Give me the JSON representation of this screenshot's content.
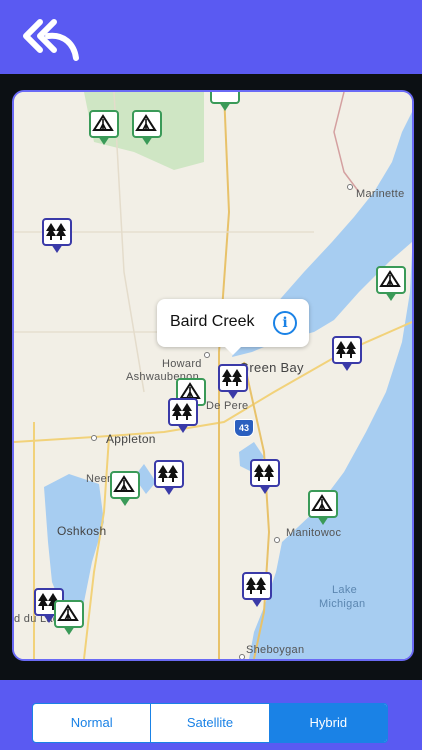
{
  "header": {
    "back_icon": "double-back-arrow-icon"
  },
  "map": {
    "callout": {
      "title": "Baird Creek",
      "info_icon": "info-icon"
    },
    "places": {
      "marinette": "Marinette",
      "green_bay": "Green Bay",
      "howard": "Howard",
      "ashwaubenon": "Ashwaubenon",
      "de_pere": "De Pere",
      "appleton": "Appleton",
      "neenah": "Neenah",
      "oshkosh": "Oshkosh",
      "manitowoc": "Manitowoc",
      "lake_michigan_1": "Lake",
      "lake_michigan_2": "Michigan",
      "sheboygan": "Sheboygan",
      "fond_du_lac": "d du Lac",
      "interstate": "43"
    },
    "pins": [
      {
        "type": "camp",
        "icon": "tent-icon"
      },
      {
        "type": "camp",
        "icon": "tent-icon"
      },
      {
        "type": "camp",
        "icon": "tent-icon"
      },
      {
        "type": "tree",
        "icon": "trees-icon"
      },
      {
        "type": "camp",
        "icon": "tent-icon"
      },
      {
        "type": "tree",
        "icon": "trees-icon"
      },
      {
        "type": "tree",
        "icon": "trees-icon"
      },
      {
        "type": "camp",
        "icon": "tent-icon"
      },
      {
        "type": "tree",
        "icon": "trees-icon"
      },
      {
        "type": "camp",
        "icon": "tent-icon"
      },
      {
        "type": "tree",
        "icon": "trees-icon"
      },
      {
        "type": "tree",
        "icon": "trees-icon"
      },
      {
        "type": "camp",
        "icon": "tent-icon"
      },
      {
        "type": "tree",
        "icon": "trees-icon"
      },
      {
        "type": "tree",
        "icon": "trees-icon"
      },
      {
        "type": "camp",
        "icon": "tent-icon"
      }
    ]
  },
  "segmented": {
    "normal": "Normal",
    "satellite": "Satellite",
    "hybrid": "Hybrid",
    "selected": "Hybrid"
  },
  "colors": {
    "bar": "#5a5af2",
    "water": "#9fc9ef",
    "accent": "#1a82e6",
    "tree_pin": "#3a3aa8",
    "camp_pin": "#3a9a58"
  }
}
